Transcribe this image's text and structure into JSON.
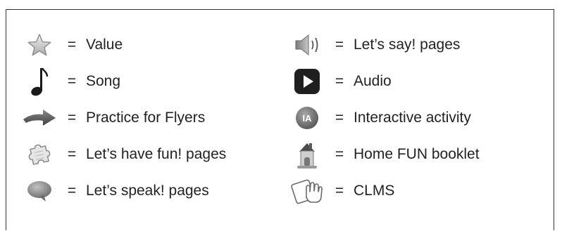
{
  "legend": {
    "equals": "=",
    "left": [
      {
        "icon": "star-icon",
        "label": "Value"
      },
      {
        "icon": "music-note-icon",
        "label": "Song"
      },
      {
        "icon": "arrow-icon",
        "label": "Practice for Flyers"
      },
      {
        "icon": "puzzle-piece-icon",
        "label": "Let’s have fun! pages"
      },
      {
        "icon": "speech-bubble-icon",
        "label": "Let’s speak! pages"
      }
    ],
    "right": [
      {
        "icon": "speaker-icon",
        "label": "Let’s say! pages"
      },
      {
        "icon": "play-button-icon",
        "label": "Audio"
      },
      {
        "icon": "ia-badge-icon",
        "label": "Interactive activity",
        "badge_text": "IA"
      },
      {
        "icon": "house-icon",
        "label": "Home FUN booklet"
      },
      {
        "icon": "tablet-hand-icon",
        "label": "CLMS"
      }
    ]
  }
}
